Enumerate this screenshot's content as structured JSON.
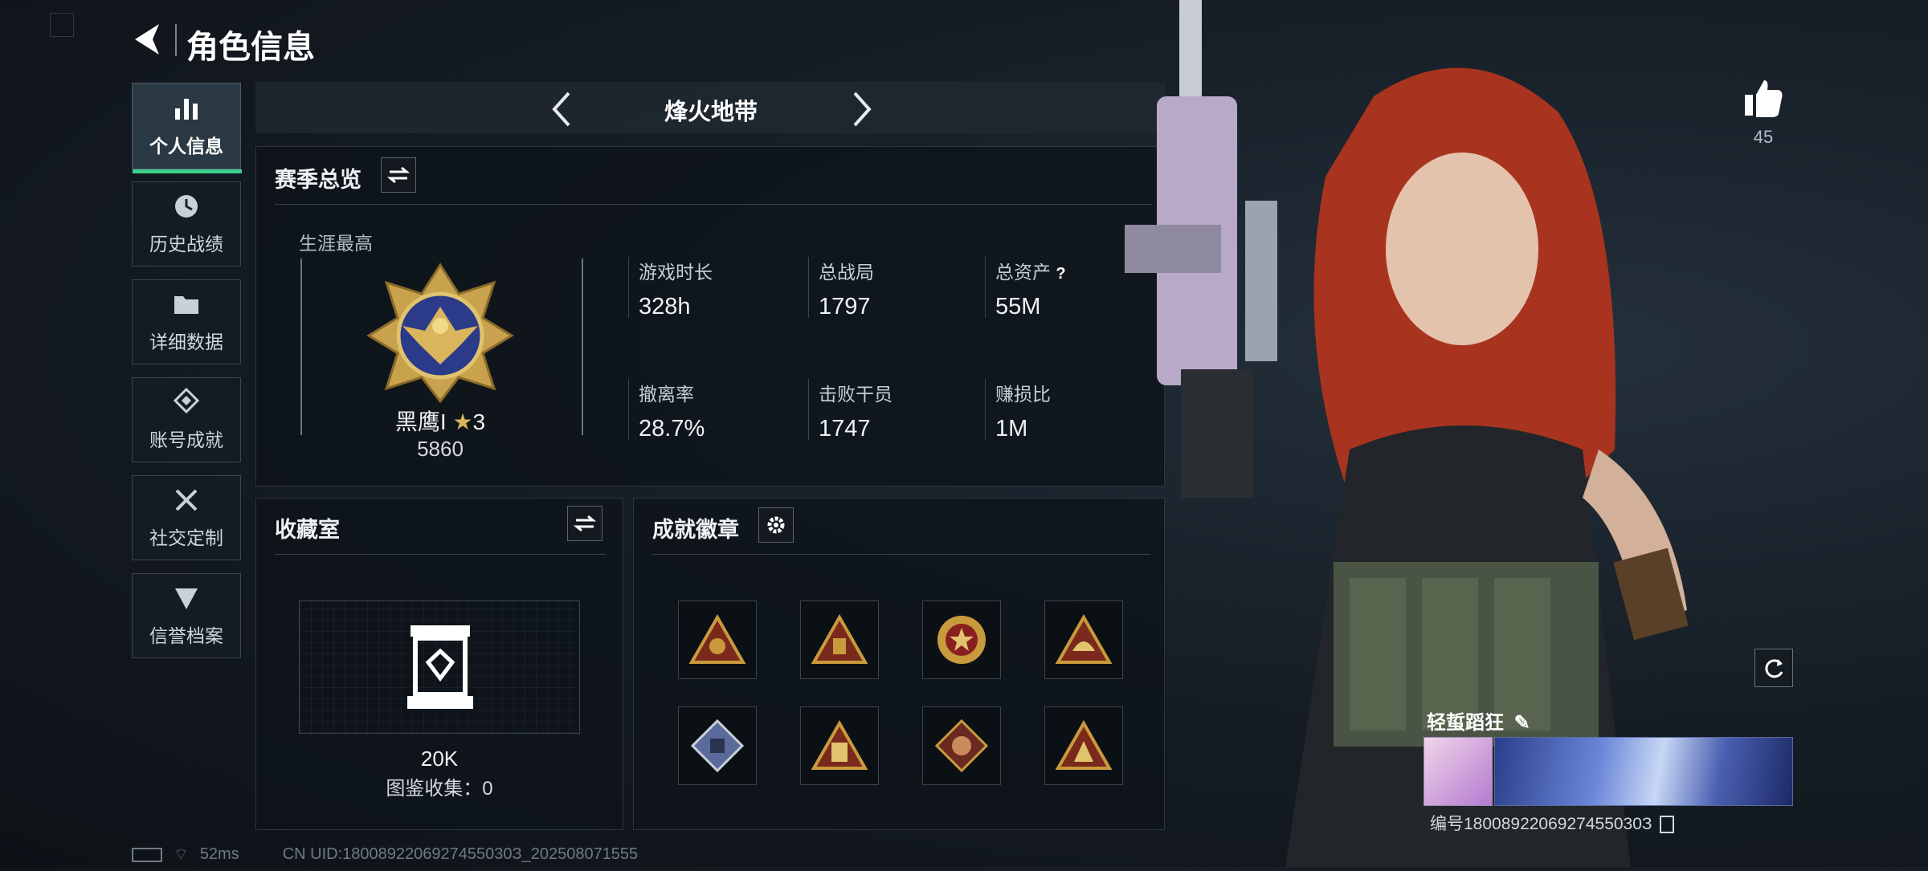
{
  "header": {
    "title": "角色信息"
  },
  "sidebar": {
    "items": [
      {
        "label": "个人信息",
        "icon": "bar-chart-icon"
      },
      {
        "label": "历史战绩",
        "icon": "clock-icon"
      },
      {
        "label": "详细数据",
        "icon": "folder-icon"
      },
      {
        "label": "账号成就",
        "icon": "achievement-icon"
      },
      {
        "label": "社交定制",
        "icon": "tools-icon"
      },
      {
        "label": "信誉档案",
        "icon": "shield-icon"
      }
    ]
  },
  "mode_selector": {
    "label": "烽火地带"
  },
  "season": {
    "title": "赛季总览",
    "career_label": "生涯最高",
    "rank_name": "黑鹰I",
    "rank_stars": "3",
    "rank_points": "5860",
    "stats": [
      {
        "label": "游戏时长",
        "value": "328h"
      },
      {
        "label": "总战局",
        "value": "1797"
      },
      {
        "label": "总资产",
        "value": "55M"
      },
      {
        "label": "撤离率",
        "value": "28.7%"
      },
      {
        "label": "击败干员",
        "value": "1747"
      },
      {
        "label": "赚损比",
        "value": "1M"
      }
    ],
    "help_mark": "?"
  },
  "collection": {
    "title": "收藏室",
    "value": "20K",
    "codex_label": "图鉴收集：0"
  },
  "badges": {
    "title": "成就徽章"
  },
  "likes": {
    "count": "45"
  },
  "profile": {
    "name": "轻蜇蹈狂",
    "id_text": "编号1800892206927455030З"
  },
  "status": {
    "ping": "52ms",
    "uid": "CN UID:1800892206927455030З_202508071555"
  },
  "colors": {
    "accent": "#3fcf8e",
    "rank_gold": "#d6b45a",
    "hair": "#a8341f"
  }
}
